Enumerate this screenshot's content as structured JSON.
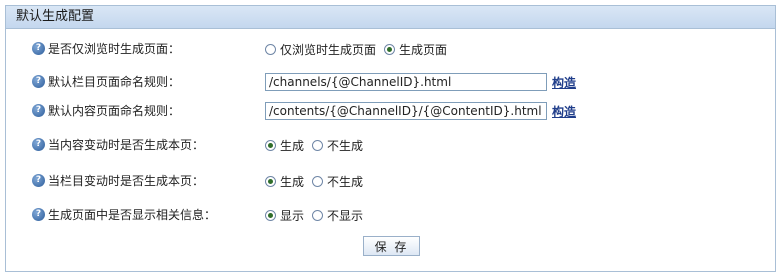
{
  "panel": {
    "title": "默认生成配置"
  },
  "rows": [
    {
      "label": "是否仅浏览时生成页面：",
      "type": "radio",
      "options": [
        {
          "label": "仅浏览时生成页面",
          "checked": false
        },
        {
          "label": "生成页面",
          "checked": true
        }
      ]
    },
    {
      "label": "默认栏目页面命名规则：",
      "type": "text",
      "value": "/channels/{@ChannelID}.html",
      "link": "构造"
    },
    {
      "label": "默认内容页面命名规则：",
      "type": "text",
      "value": "/contents/{@ChannelID}/{@ContentID}.html",
      "link": "构造"
    },
    {
      "label": "当内容变动时是否生成本页：",
      "type": "radio",
      "options": [
        {
          "label": "生成",
          "checked": true
        },
        {
          "label": "不生成",
          "checked": false
        }
      ]
    },
    {
      "label": "当栏目变动时是否生成本页：",
      "type": "radio",
      "options": [
        {
          "label": "生成",
          "checked": true
        },
        {
          "label": "不生成",
          "checked": false
        }
      ]
    },
    {
      "label": "生成页面中是否显示相关信息：",
      "type": "radio",
      "options": [
        {
          "label": "显示",
          "checked": true
        },
        {
          "label": "不显示",
          "checked": false
        }
      ]
    }
  ],
  "save_label": "保 存",
  "icons": {
    "help": "help-icon"
  }
}
